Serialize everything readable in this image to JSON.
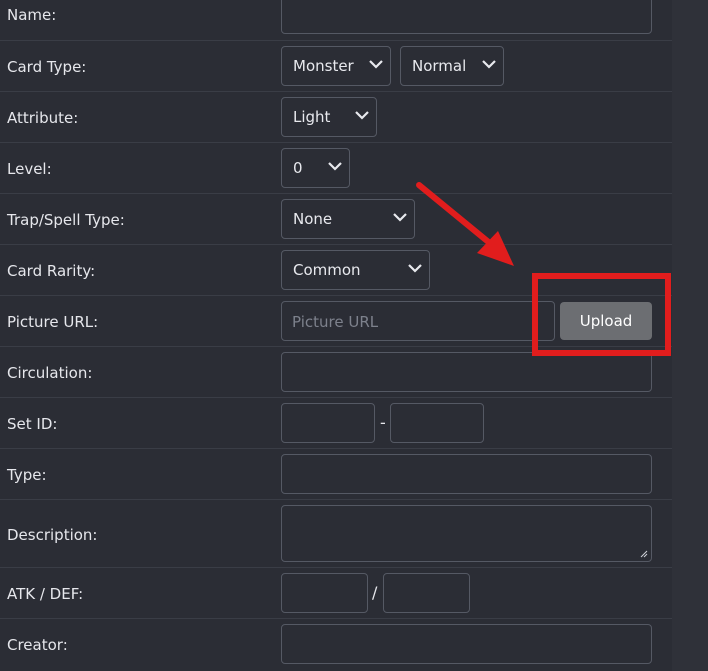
{
  "form": {
    "name_label": "Name:",
    "card_type_label": "Card Type:",
    "card_type_value": "Monster",
    "card_subtype_value": "Normal",
    "attribute_label": "Attribute:",
    "attribute_value": "Light",
    "level_label": "Level:",
    "level_value": "0",
    "trap_spell_label": "Trap/Spell Type:",
    "trap_spell_value": "None",
    "rarity_label": "Card Rarity:",
    "rarity_value": "Common",
    "picture_url_label": "Picture URL:",
    "picture_url_placeholder": "Picture URL",
    "upload_label": "Upload",
    "circulation_label": "Circulation:",
    "set_id_label": "Set ID:",
    "set_id_separator": "-",
    "type_label": "Type:",
    "description_label": "Description:",
    "atk_def_label": "ATK / DEF:",
    "atk_def_separator": "/",
    "creator_label": "Creator:"
  },
  "colors": {
    "background": "#2b2d35",
    "field_border": "#555964",
    "upload_button": "#6c6e72",
    "annotation_red": "#e11d1d"
  }
}
